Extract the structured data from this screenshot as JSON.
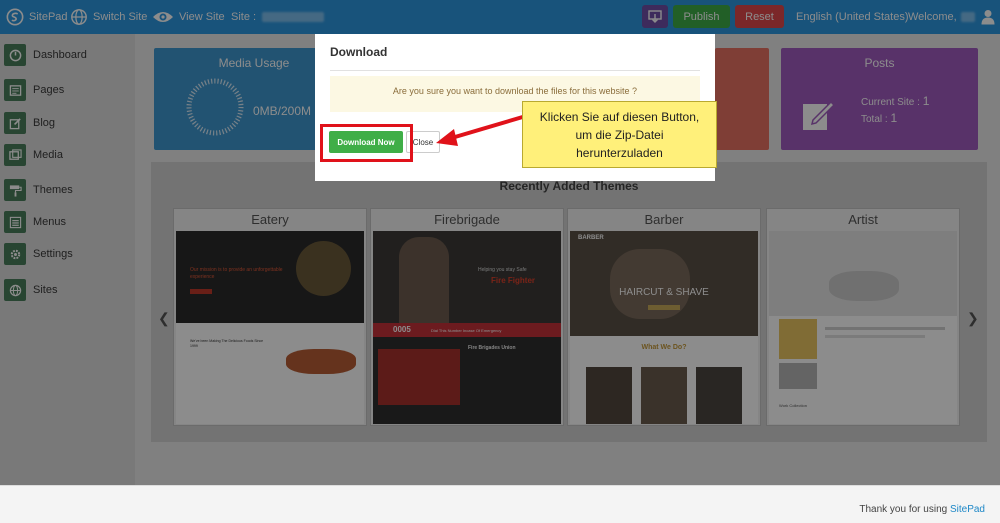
{
  "topbar": {
    "brand": "SitePad",
    "switch_site": "Switch Site",
    "view_site": "View Site",
    "site_label": "Site :",
    "publish": "Publish",
    "reset": "Reset",
    "language": "English (United States)",
    "welcome": "Welcome,"
  },
  "sidebar": {
    "items": [
      {
        "label": "Dashboard"
      },
      {
        "label": "Pages"
      },
      {
        "label": "Blog"
      },
      {
        "label": "Media"
      },
      {
        "label": "Themes"
      },
      {
        "label": "Menus"
      },
      {
        "label": "Settings"
      },
      {
        "label": "Sites"
      }
    ]
  },
  "cards": {
    "media": {
      "title": "Media Usage",
      "value": "0MB/200M"
    },
    "posts": {
      "title": "Posts",
      "current_label": "Current Site :",
      "current_value": "1",
      "total_label": "Total :",
      "total_value": "1"
    }
  },
  "themes": {
    "heading": "Recently Added Themes",
    "items": [
      {
        "name": "Eatery",
        "hero": "Our mission is to provide an unforgettable experience",
        "sub": "We've been Making The Delicious Foods Since 1999"
      },
      {
        "name": "Firebrigade",
        "hero": "Helping you stay Safe",
        "accent": "Fire Fighter",
        "counter": "0005",
        "bar": "Dial This Number Incase Of Emergency",
        "sub": "Fire Brigades Union"
      },
      {
        "name": "Barber",
        "brand": "BARBER",
        "hero": "HAIRCUT & SHAVE",
        "sub": "What We Do?"
      },
      {
        "name": "Artist",
        "sub": "Work Collection"
      }
    ]
  },
  "modal": {
    "title": "Download",
    "message": "Are you sure you want to download the files for this website ?",
    "download": "Download Now",
    "close": "Close"
  },
  "callout": {
    "line1": "Klicken Sie auf diesen Button,",
    "line2": "um die Zip-Datei",
    "line3": "herunterzuladen"
  },
  "footer": {
    "text": "Thank you for using",
    "link": "SitePad"
  },
  "colors": {
    "topbar": "#2d98e0",
    "publish": "#3fae47",
    "reset": "#e0474c",
    "media_card": "#3f97cf",
    "posts_card": "#a15bbf",
    "highlight": "#e0121a",
    "callout": "#fff07a"
  }
}
